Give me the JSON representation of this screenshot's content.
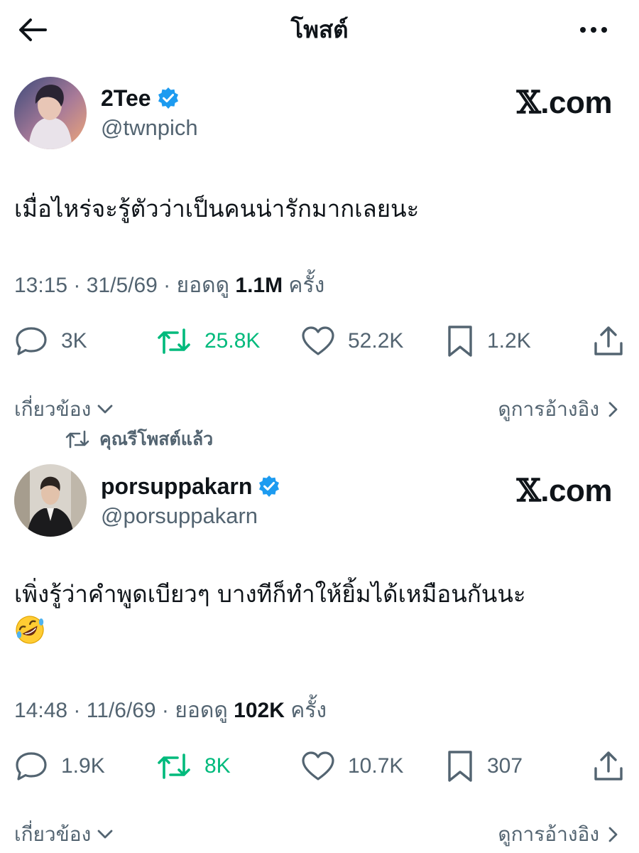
{
  "header": {
    "title": "โพสต์",
    "back_icon": "arrow-left-icon",
    "more_icon": "more-horizontal-icon"
  },
  "colors": {
    "retweet_green": "#00ba7c",
    "verified_blue": "#1d9bf0",
    "muted_text": "#536471",
    "main_text": "#0f1419"
  },
  "posts": [
    {
      "author_name": "2Tee",
      "handle": "@twnpich",
      "site_label_x": "𝕏",
      "site_label_rest": ".com",
      "text": "เมื่อไหร่จะรู้ตัวว่าเป็นคนน่ารักมากเลยนะ",
      "meta_prefix": "13:15 · 31/5/69 · ยอดดู ",
      "views": "1.1M",
      "meta_suffix": " ครั้ง",
      "replies": "3K",
      "reposts": "25.8K",
      "likes": "52.2K",
      "bookmarks": "1.2K",
      "related_label": "เกี่ยวข้อง",
      "quotes_label": "ดูการอ้างอิง"
    },
    {
      "author_name": "porsuppakarn",
      "handle": "@porsuppakarn",
      "site_label_x": "𝕏",
      "site_label_rest": ".com",
      "text": "เพิ่งรู้ว่าคำพูดเบียวๆ บางทีก็ทำให้ยิ้มได้เหมือนกันนะ",
      "emoji": "rolling-on-floor-laughing",
      "meta_prefix": "14:48 · 11/6/69 · ยอดดู ",
      "views": "102K",
      "meta_suffix": " ครั้ง",
      "replies": "1.9K",
      "reposts": "8K",
      "likes": "10.7K",
      "bookmarks": "307",
      "related_label": "เกี่ยวข้อง",
      "quotes_label": "ดูการอ้างอิง"
    }
  ],
  "repost_note": "คุณรีโพสต์แล้ว"
}
